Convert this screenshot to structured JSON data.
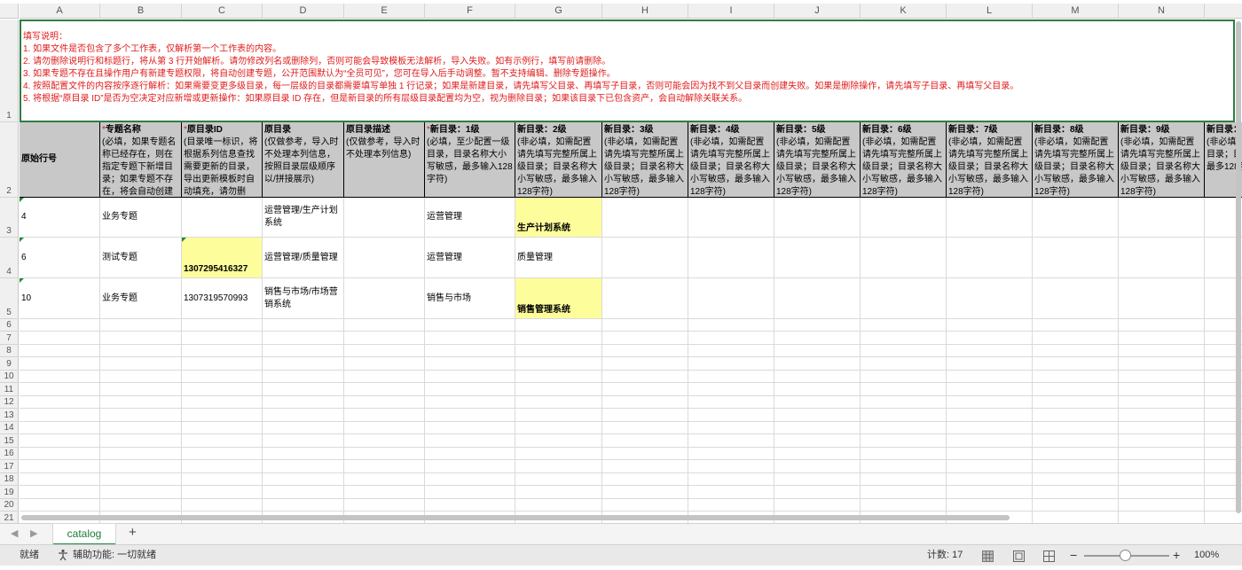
{
  "columns": [
    "A",
    "B",
    "C",
    "D",
    "E",
    "F",
    "G",
    "H",
    "I",
    "J",
    "K",
    "L",
    "M",
    "N"
  ],
  "rows": [
    "1",
    "2",
    "3",
    "4",
    "5",
    "6",
    "7",
    "8",
    "9",
    "10",
    "11",
    "12",
    "13",
    "14",
    "15",
    "16",
    "17",
    "18",
    "19",
    "20",
    "21"
  ],
  "instructions": {
    "title": "填写说明：",
    "lines": [
      "1. 如果文件是否包含了多个工作表，仅解析第一个工作表的内容。",
      "2. 请勿删除说明行和标题行，将从第 3 行开始解析。请勿修改列名或删除列，否则可能会导致模板无法解析，导入失败。如有示例行，填写前请删除。",
      "3. 如果专题不存在且操作用户有新建专题权限，将自动创建专题，公开范围默认为“全员可见”，您可在导入后手动调整。暂不支持编辑、删除专题操作。",
      "4. 按照配置文件的内容按序逐行解析：如果需要变更多级目录，每一层级的目录都需要填写单独 1 行记录；如果是新建目录，请先填写父目录、再填写子目录，否则可能会因为找不到父目录而创建失败。如果是删除操作，请先填写子目录、再填写父目录。",
      "5. 将根据“原目录 ID”是否为空决定对应新增或更新操作：如果原目录 ID 存在，但是新目录的所有层级目录配置均为空，视为删除目录；如果该目录下已包含资产，会自动解除关联关系。"
    ]
  },
  "headers": {
    "A": {
      "title": "原始行号",
      "desc": ""
    },
    "B": {
      "req": "*",
      "title": "专题名称",
      "desc": "(必填，如果专题名称已经存在，则在指定专题下新增目录；如果专题不存在，将会自动创建"
    },
    "C": {
      "req": "*",
      "title": "原目录ID",
      "desc": "(目录唯一标识，将根据系列信息查找需要更新的目录，导出更新模板时自动填充，请勿删"
    },
    "D": {
      "title": "原目录",
      "desc": "(仅做参考，导入时不处理本列信息，按照目录层级顺序以/拼接展示)"
    },
    "E": {
      "title": "原目录描述",
      "desc": "(仅做参考，导入时不处理本列信息)"
    },
    "F": {
      "req": "*",
      "title": "新目录：1级",
      "desc": "(必填，至少配置一级目录，目录名称大小写敏感，最多输入128字符)"
    },
    "G": {
      "title": "新目录：2级",
      "desc": "(非必填，如需配置请先填写完整所属上级目录；目录名称大小写敏感，最多输入128字符)"
    },
    "H": {
      "title": "新目录：3级",
      "desc": "(非必填，如需配置请先填写完整所属上级目录；目录名称大小写敏感，最多输入128字符)"
    },
    "I": {
      "title": "新目录：4级",
      "desc": "(非必填，如需配置请先填写完整所属上级目录；目录名称大小写敏感，最多输入128字符)"
    },
    "J": {
      "title": "新目录：5级",
      "desc": "(非必填，如需配置请先填写完整所属上级目录；目录名称大小写敏感，最多输入128字符)"
    },
    "K": {
      "title": "新目录：6级",
      "desc": "(非必填，如需配置请先填写完整所属上级目录；目录名称大小写敏感，最多输入128字符)"
    },
    "L": {
      "title": "新目录：7级",
      "desc": "(非必填，如需配置请先填写完整所属上级目录；目录名称大小写敏感，最多输入128字符)"
    },
    "M": {
      "title": "新目录：8级",
      "desc": "(非必填，如需配置请先填写完整所属上级目录；目录名称大小写敏感，最多输入128字符)"
    },
    "N": {
      "title": "新目录：9级",
      "desc": "(非必填，如需配置请先填写完整所属上级目录；目录名称大小写敏感，最多输入128字符)"
    },
    "O": {
      "title": "新目录：1",
      "desc": "(非必填，先填写完整目录；目录写敏感，最多128字符)"
    }
  },
  "data": {
    "r3": {
      "A": "4",
      "B": "业务专题",
      "C": "",
      "D": "运营管理/生产计划系统",
      "E": "",
      "F": "运营管理",
      "G": "生产计划系统"
    },
    "r4": {
      "A": "6",
      "B": "测试专题",
      "C": "1307295416327",
      "D": "运营管理/质量管理",
      "E": "",
      "F": "运营管理",
      "G": "质量管理"
    },
    "r5": {
      "A": "10",
      "B": "业务专题",
      "C": "1307319570993",
      "D": "销售与市场/市场营销系统",
      "E": "",
      "F": "销售与市场",
      "G": "销售管理系统"
    }
  },
  "tabs": {
    "nav_prev": "◀",
    "nav_next": "▶",
    "active": "catalog",
    "add": "+"
  },
  "status": {
    "ready": "就绪",
    "accessibility": "辅助功能: 一切就绪",
    "count": "计数: 17",
    "zoom_minus": "−",
    "zoom_plus": "+",
    "zoom": "100%"
  }
}
